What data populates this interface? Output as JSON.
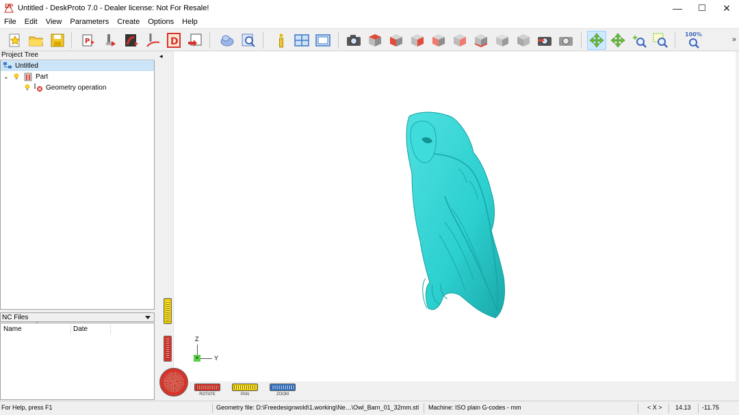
{
  "window": {
    "title": "Untitled - DeskProto 7.0 - Dealer license: Not For Resale!",
    "logo_text": "DP",
    "minimize": "—",
    "maximize": "☐",
    "close": "✕"
  },
  "menu": [
    "File",
    "Edit",
    "View",
    "Parameters",
    "Create",
    "Options",
    "Help"
  ],
  "toolbar": {
    "zoom_label": "100%",
    "overflow": "»",
    "buttons": [
      "new-project",
      "open-project",
      "save-project",
      "part-parameters",
      "operation-parameters",
      "geometry-parameters",
      "toolpath",
      "delete",
      "output",
      "export",
      "shaded-view",
      "zoom-view",
      "info",
      "window-layout",
      "view-toggle",
      "camera",
      "view-top",
      "view-front",
      "view-right",
      "view-left",
      "view-back",
      "view-bottom",
      "view-iso",
      "view-iso-back",
      "render",
      "render-alt",
      "rotate-mode",
      "pan-mode",
      "zoom-mode",
      "zoom-window",
      "zoom-fit"
    ]
  },
  "project_tree": {
    "header": "Project Tree",
    "items": {
      "root": "Untitled",
      "part": "Part",
      "operation": "Geometry operation"
    }
  },
  "nc_files": {
    "header": "NC Files",
    "col_name": "Name",
    "col_date": "Date"
  },
  "viewport": {
    "collapse": "◂",
    "axis_z": "Z",
    "axis_y": "Y",
    "ctrl_rotate": "ROTATE",
    "ctrl_pan": "PAN",
    "ctrl_zoom": "ZOOM",
    "model_color": "#2ccfcf"
  },
  "status": {
    "help": "For Help, press F1",
    "geometry": "Geometry file: D:\\Freedesignwold\\1.working\\Ne…\\Owl_Barn_01_32mm.stl",
    "machine": "Machine: ISO plain G-codes - mm",
    "coord_mode": "< X >",
    "coord_x": "14.13",
    "coord_y": "-11.75"
  }
}
